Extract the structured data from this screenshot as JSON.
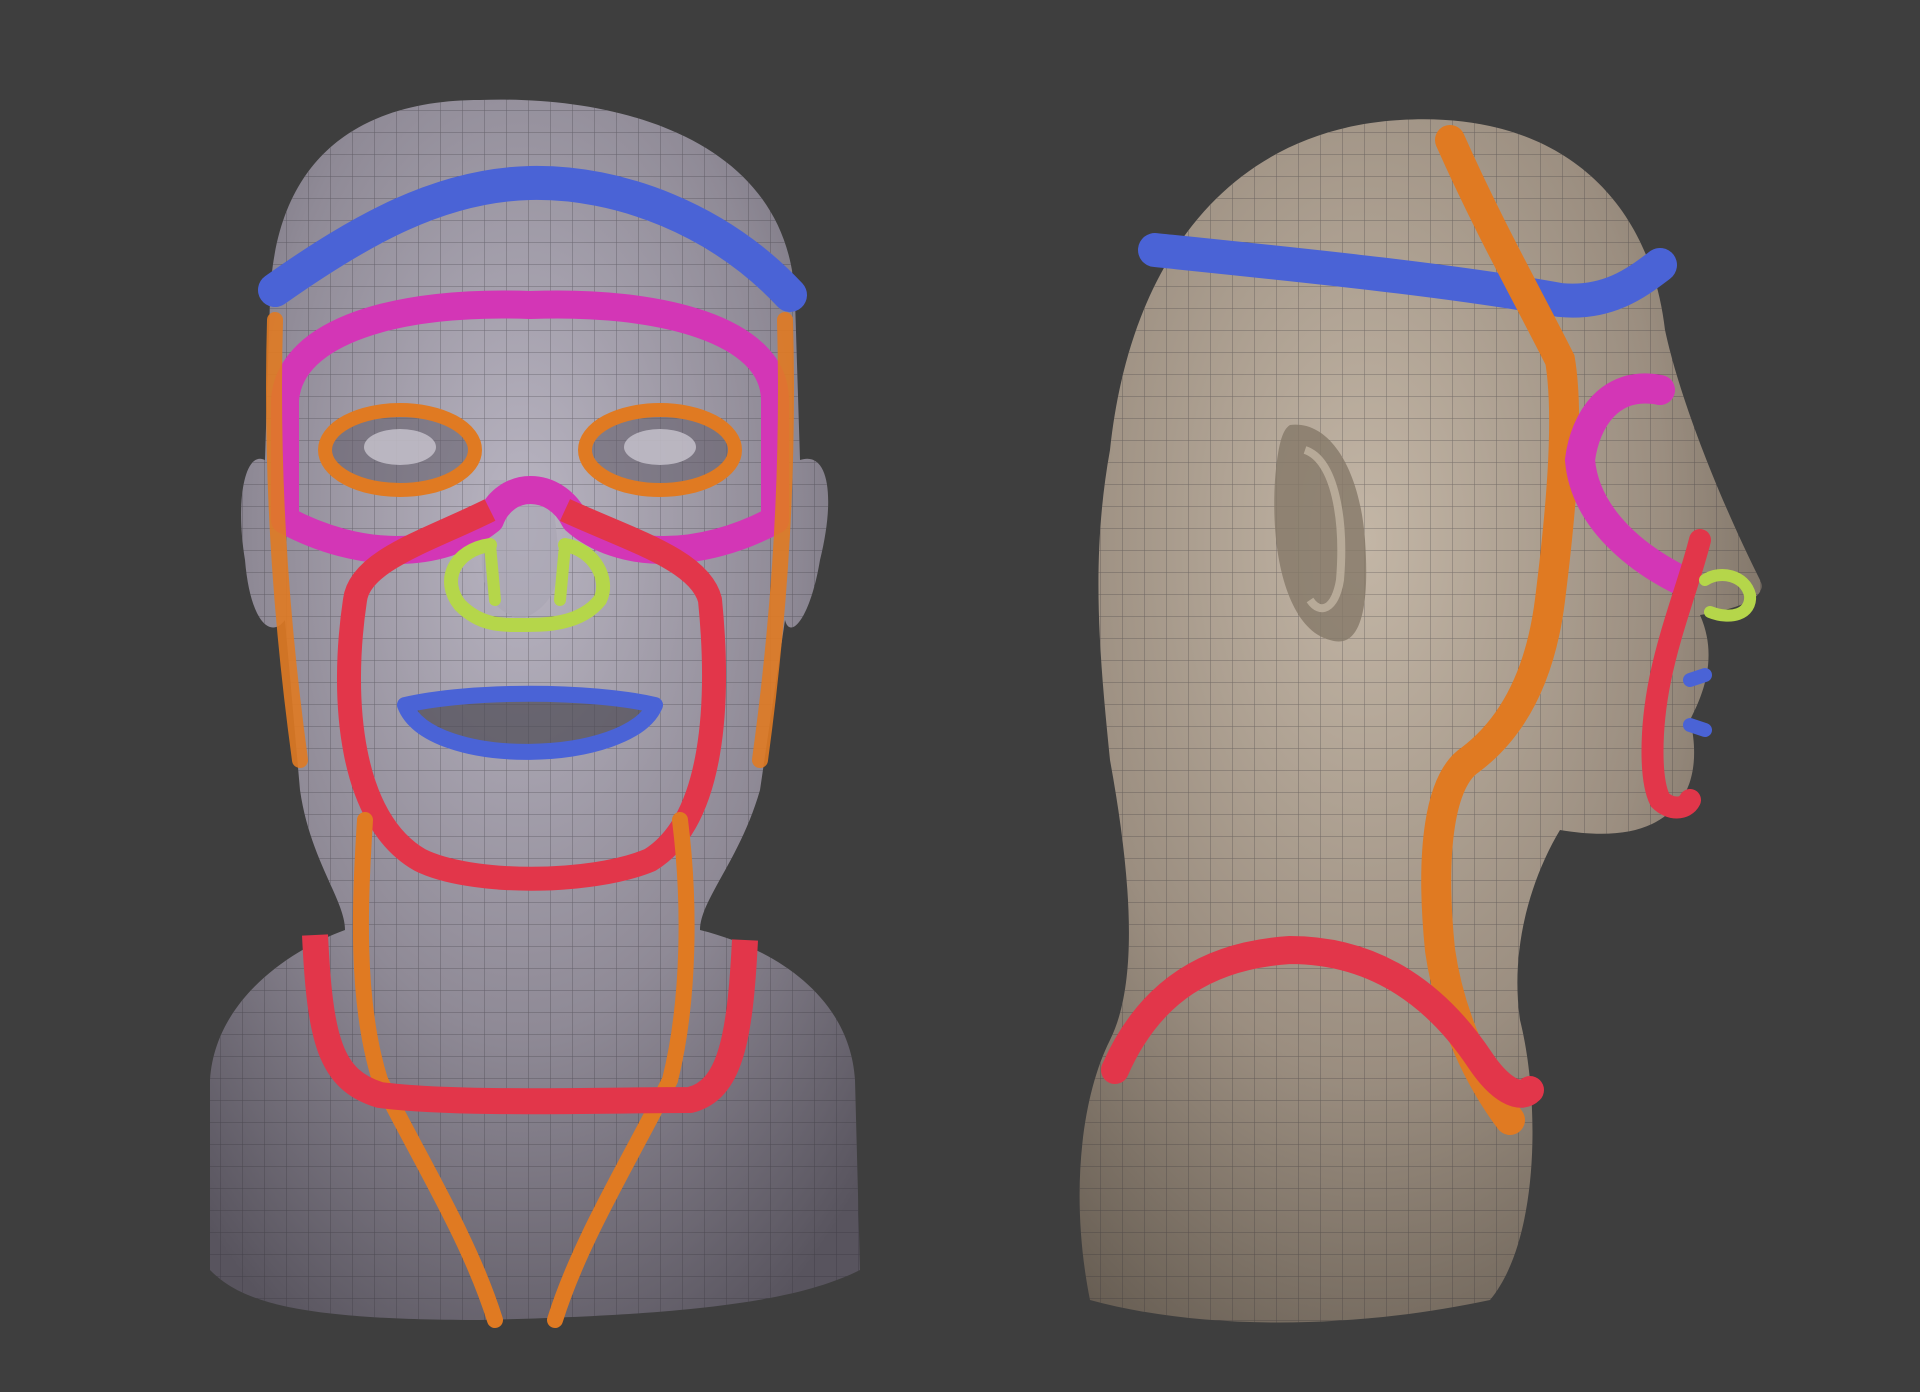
{
  "scene": {
    "background_color": "#3e3e3e",
    "views": [
      {
        "name": "front-view",
        "skin_color": "#8f8a96",
        "skin_highlight": "#b9b5c2",
        "skin_shadow": "#58545e"
      },
      {
        "name": "side-view",
        "skin_color": "#9b8e80",
        "skin_highlight": "#c3b6a6",
        "skin_shadow": "#5f564c"
      }
    ],
    "wire_color": "#2d2a30",
    "loop_colors": {
      "forehead": "#4a63d6",
      "brow": "#d336b6",
      "eye": "#e07a22",
      "face_outline": "#e2364a",
      "nose": "#b5d64a",
      "mouth": "#4a63d6",
      "neck": "#e07a22",
      "collar": "#e2364a"
    }
  }
}
